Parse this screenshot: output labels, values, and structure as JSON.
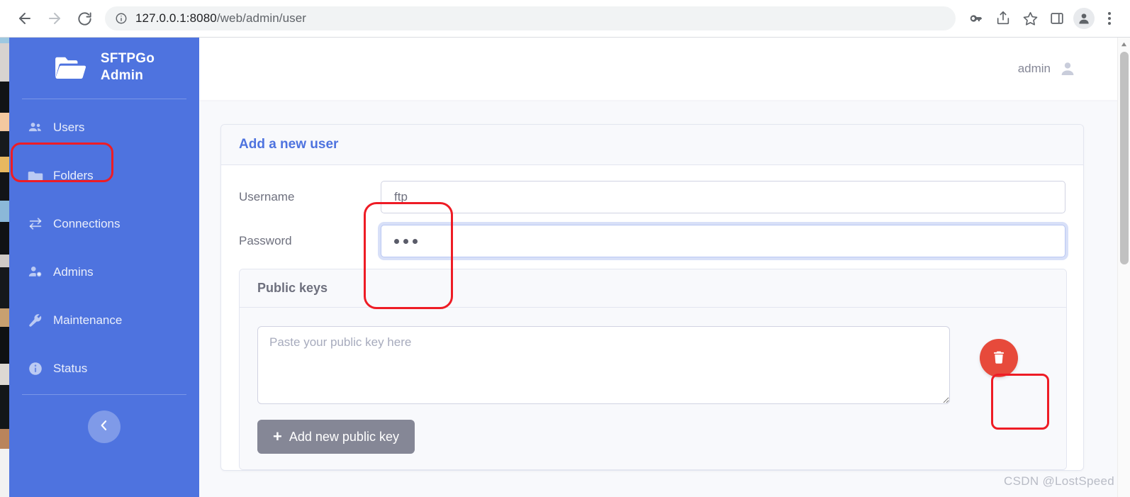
{
  "browser": {
    "back_label": "Back",
    "forward_label": "Forward",
    "reload_label": "Reload",
    "url_host": "127.0.0.1:8080",
    "url_path": "/web/admin/user",
    "url_full": "127.0.0.1:8080/web/admin/user",
    "site_info_icon": "site-info-icon",
    "actions": [
      {
        "name": "password-key-icon",
        "label": "Passwords"
      },
      {
        "name": "share-icon",
        "label": "Share this page"
      },
      {
        "name": "bookmark-star-icon",
        "label": "Bookmark this tab"
      },
      {
        "name": "side-panel-icon",
        "label": "Side panel"
      },
      {
        "name": "profile-avatar-icon",
        "label": "Profile"
      },
      {
        "name": "kebab-menu-icon",
        "label": "Customize and control"
      }
    ]
  },
  "sidebar": {
    "brand_line1": "SFTPGo",
    "brand_line2": "Admin",
    "brand_icon": "open-folder-icon",
    "items": [
      {
        "label": "Users",
        "icon": "users-group-icon",
        "active": true
      },
      {
        "label": "Folders",
        "icon": "folder-icon",
        "active": false
      },
      {
        "label": "Connections",
        "icon": "transfer-arrows-icon",
        "active": false
      },
      {
        "label": "Admins",
        "icon": "user-gear-icon",
        "active": false
      },
      {
        "label": "Maintenance",
        "icon": "wrench-icon",
        "active": false
      },
      {
        "label": "Status",
        "icon": "info-circle-icon",
        "active": false
      }
    ],
    "collapse_icon": "chevron-left-icon",
    "collapse_label": "Toggle sidebar"
  },
  "topbar": {
    "user_name": "admin",
    "user_icon": "user-avatar-icon"
  },
  "form_card": {
    "title": "Add a new user",
    "fields": [
      {
        "label": "Username",
        "value": "ftp",
        "placeholder": "",
        "type": "text",
        "focused": false
      },
      {
        "label": "Password",
        "value": "•••",
        "placeholder": "",
        "type": "password",
        "focused": true
      }
    ]
  },
  "public_keys": {
    "title": "Public keys",
    "textarea_placeholder": "Paste your public key here",
    "textarea_value": "",
    "delete_icon": "trash-icon",
    "delete_label": "Delete public key",
    "add_button_label": "Add new public key",
    "add_button_icon": "plus-icon"
  },
  "annotations": [
    {
      "name": "annotation-users",
      "color": "#ee1c25"
    },
    {
      "name": "annotation-credentials",
      "color": "#ee1c25"
    },
    {
      "name": "annotation-delete-key",
      "color": "#ee1c25"
    }
  ],
  "watermark": {
    "text": "CSDN @LostSpeed"
  },
  "colors": {
    "sidebar_blue": "#4e73df",
    "accent_blue": "#4e73df",
    "danger_red": "#e74a3b",
    "annotation_red": "#ee1c25",
    "muted_gray": "#858796",
    "page_bg": "#f8f9fc"
  },
  "scrollbar": {
    "up_arrow": "scroll-up-arrow",
    "thumb": "scroll-thumb"
  }
}
